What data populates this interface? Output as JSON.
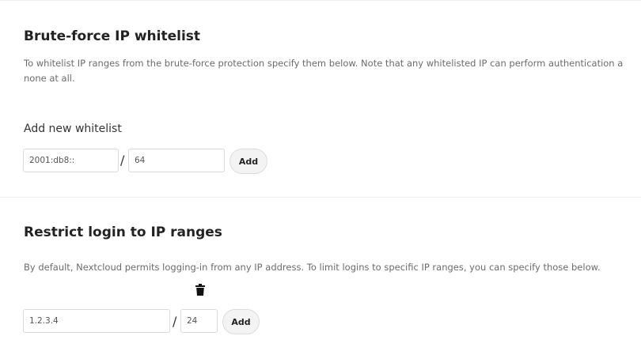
{
  "bruteforce": {
    "title": "Brute-force IP whitelist",
    "description_line1": "To whitelist IP ranges from the brute-force protection specify them below. Note that any whitelisted IP can perform authentication a",
    "description_line2": "none at all.",
    "add_label": "Add new whitelist",
    "ip_value": "2001:db8::",
    "slash": "/",
    "mask_value": "64",
    "add_button": "Add"
  },
  "restrict": {
    "title": "Restrict login to IP ranges",
    "description": "By default, Nextcloud permits logging-in from any IP address. To limit logins to specific IP ranges, you can specify those below.",
    "ip_value": "1.2.3.4",
    "slash": "/",
    "mask_value": "24",
    "add_button": "Add",
    "delete_icon": "trash-icon"
  }
}
